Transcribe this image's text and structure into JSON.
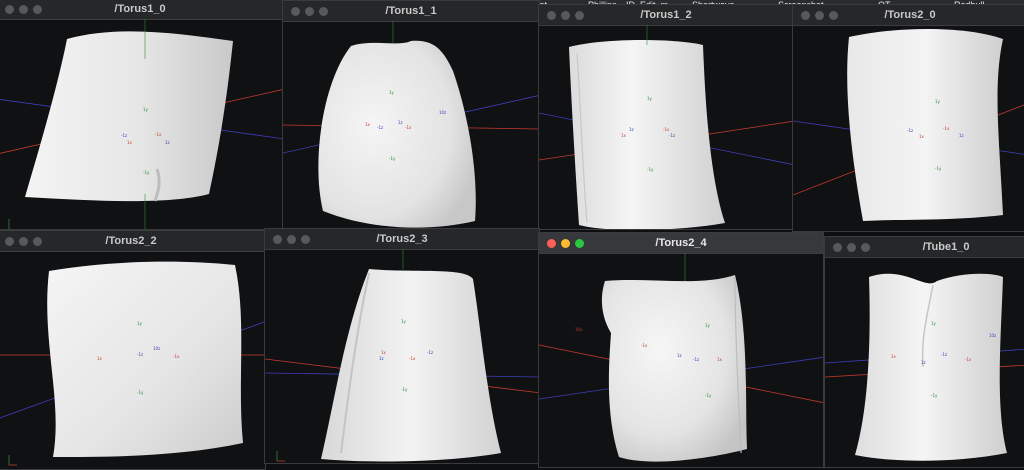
{
  "menubar": {
    "items": [
      "enshot",
      "Phillips",
      "ID_Edit_m",
      "Shortwave",
      "Screenshot",
      "QT",
      "Redbull"
    ]
  },
  "windows": [
    {
      "title": "/Torus1_0"
    },
    {
      "title": "/Torus1_1"
    },
    {
      "title": "/Torus1_2"
    },
    {
      "title": "/Torus2_0"
    },
    {
      "title": "/Torus2_2"
    },
    {
      "title": "/Torus2_3"
    },
    {
      "title": "/Torus2_4"
    },
    {
      "title": "/Tube1_0"
    }
  ],
  "axis_labels": {
    "plus_y": "1y",
    "minus_y": "-1y",
    "plus_x": "1x",
    "minus_x": "-1x",
    "plus_z": "1z",
    "minus_z": "-1z",
    "far_x": "10x",
    "far_z": "10z"
  },
  "colors": {
    "background": "#101113",
    "mesh": "#ebebeb",
    "x_axis": "#c23a2f",
    "y_axis": "#2f8a3a",
    "z_axis": "#3c3fb8",
    "title_bar": "#262729"
  }
}
